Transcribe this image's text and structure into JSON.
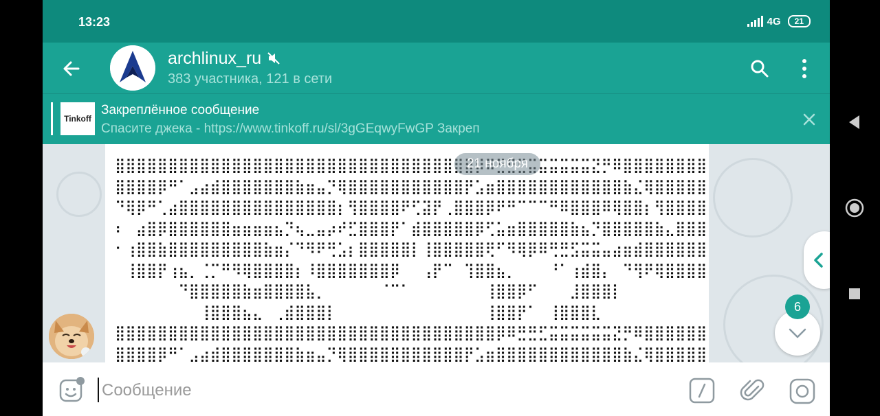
{
  "status": {
    "time": "13:23",
    "network": "4G",
    "battery": "21"
  },
  "header": {
    "title": "archlinux_ru",
    "subtitle": "383 участника, 121 в сети"
  },
  "pinned": {
    "title": "Закреплённое сообщение",
    "text": "Спасите джека - https://www.tinkoff.ru/sl/3gGEqwyFwGP Закреп",
    "thumb_text": "Tinkoff"
  },
  "chat": {
    "date_chip": "21 ноября",
    "unread_count": "6"
  },
  "input": {
    "placeholder": "Сообщение"
  },
  "icons": {
    "back": "back-arrow-icon",
    "mute": "mute-icon",
    "search": "search-icon",
    "menu": "more-vertical-icon",
    "close": "close-icon",
    "sticker": "sticker-icon",
    "command": "slash-command-icon",
    "attach": "paperclip-icon",
    "camera": "instagram-camera-icon"
  },
  "colors": {
    "header": "#1aa394",
    "statusbar": "#0e8a7d",
    "subtitle": "#a7e2da"
  }
}
